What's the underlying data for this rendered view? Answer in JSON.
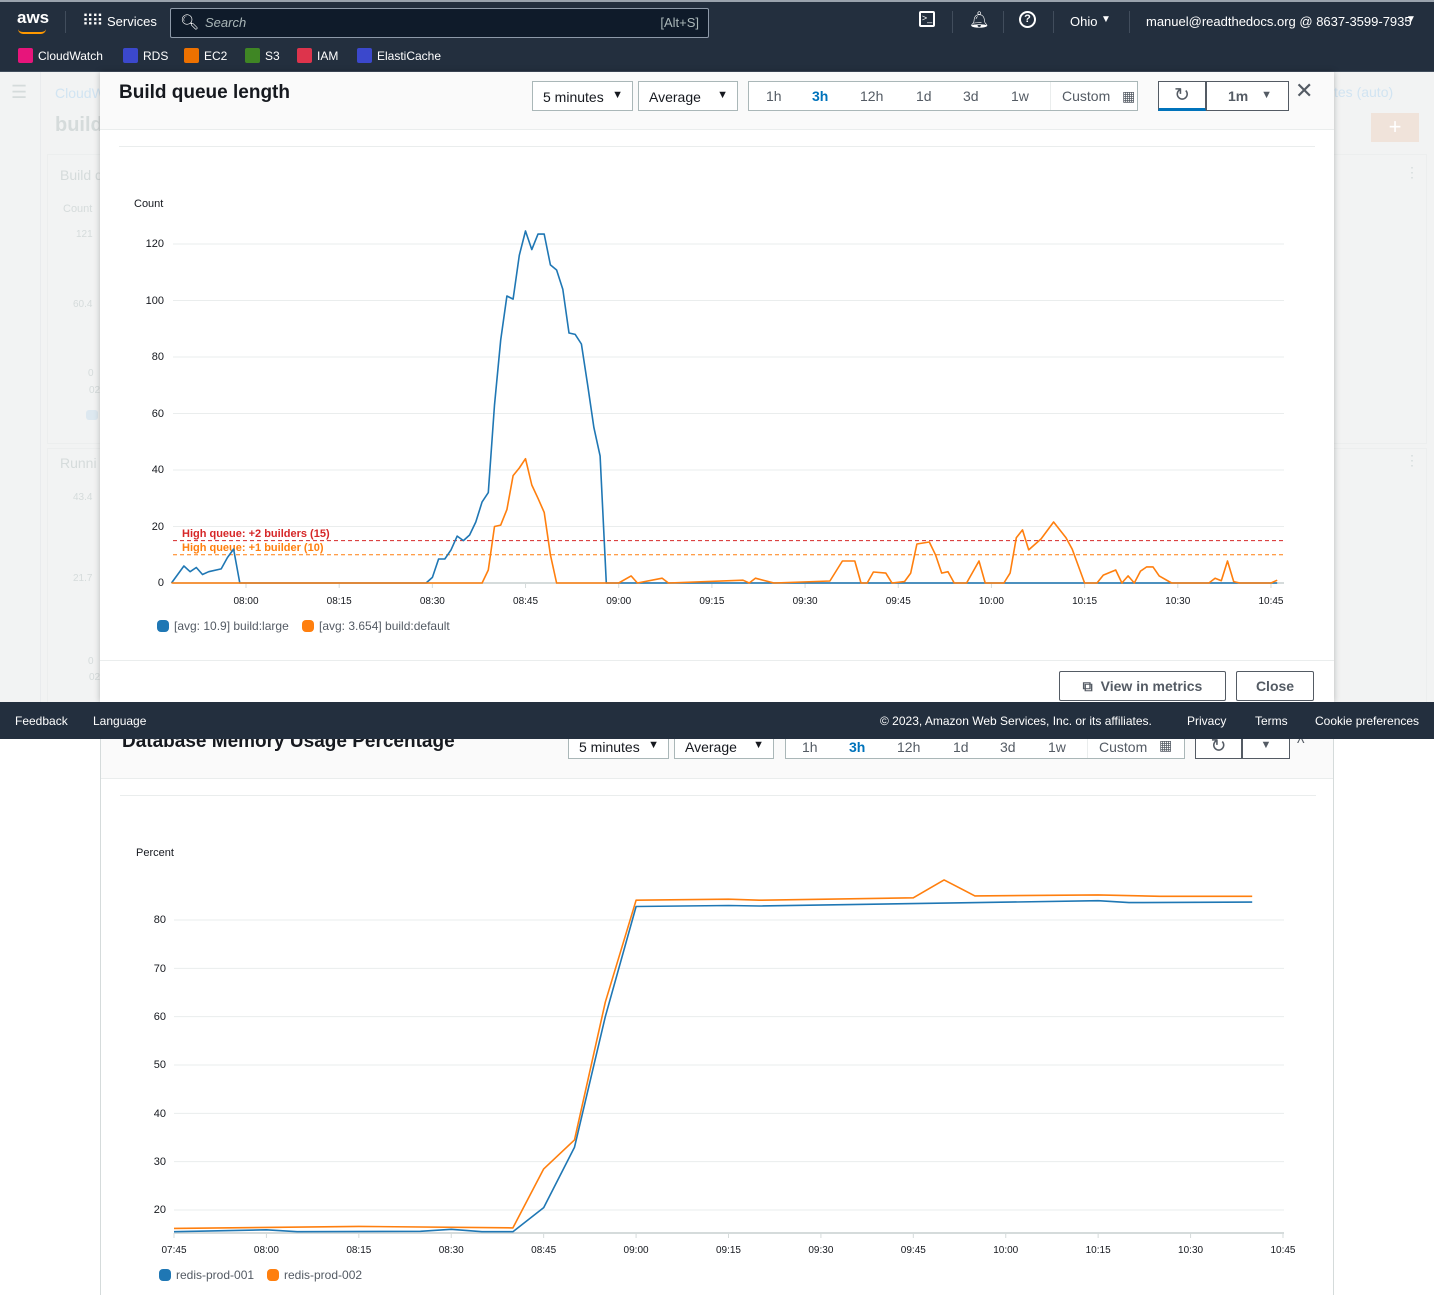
{
  "nav": {
    "logo": "aws",
    "services": "Services",
    "search_placeholder": "Search",
    "search_shortcut": "[Alt+S]",
    "region": "Ohio",
    "account": "manuel@readthedocs.org @ 8637-3599-7935"
  },
  "favorites": [
    {
      "label": "CloudWatch",
      "color": "#e7157b"
    },
    {
      "label": "RDS",
      "color": "#3b48cc"
    },
    {
      "label": "EC2",
      "color": "#ed7100"
    },
    {
      "label": "S3",
      "color": "#3f8624"
    },
    {
      "label": "IAM",
      "color": "#dd344c"
    },
    {
      "label": "ElastiCache",
      "color": "#3b48cc"
    }
  ],
  "background": {
    "breadcrumb": "CloudW",
    "title": "build",
    "widget1_title": "Build q",
    "widget1_unit": "Count",
    "widget1_ticks": [
      "121",
      "60.4",
      "0"
    ],
    "widget1_x": "02",
    "widget2_title": "Runni",
    "widget2_ticks": [
      "43.4",
      "21.7",
      "0"
    ],
    "widget2_x": "02",
    "period_link": "tes (auto)"
  },
  "modal1": {
    "title": "Build queue length",
    "period": "5 minutes",
    "stat": "Average",
    "ranges": [
      "1h",
      "3h",
      "12h",
      "1d",
      "3d",
      "1w"
    ],
    "active_range": "3h",
    "custom": "Custom",
    "refresh_interval": "1m",
    "view_in_metrics": "View in metrics",
    "close": "Close"
  },
  "modal2": {
    "title": "Database Memory Usage Percentage",
    "period": "5 minutes",
    "stat": "Average",
    "ranges": [
      "1h",
      "3h",
      "12h",
      "1d",
      "3d",
      "1w"
    ],
    "active_range": "3h",
    "custom": "Custom"
  },
  "footer": {
    "feedback": "Feedback",
    "language": "Language",
    "copyright": "© 2023, Amazon Web Services, Inc. or its affiliates.",
    "privacy": "Privacy",
    "terms": "Terms",
    "cookies": "Cookie preferences"
  },
  "chart_data": [
    {
      "type": "line",
      "ylabel": "Count",
      "ylim": [
        0,
        120
      ],
      "yticks": [
        "0",
        "20",
        "40",
        "60",
        "80",
        "100",
        "120"
      ],
      "xticks": [
        "08:00",
        "08:15",
        "08:30",
        "08:45",
        "09:00",
        "09:15",
        "09:30",
        "09:45",
        "10:00",
        "10:15",
        "10:30",
        "10:45"
      ],
      "grid": true,
      "legend": "bottom-left",
      "annotations": [
        {
          "label": "High queue: +2 builders (15)",
          "value": 15,
          "color": "#d62728"
        },
        {
          "label": "High queue: +1 builder (10)",
          "value": 10,
          "color": "#ff7f0e"
        }
      ],
      "series": [
        {
          "name": "[avg: 10.9] build:large",
          "color": "#1f77b4",
          "points": [
            [
              "07:48",
              0
            ],
            [
              "07:49",
              3
            ],
            [
              "07:50",
              6
            ],
            [
              "07:51",
              4
            ],
            [
              "07:52",
              5.5
            ],
            [
              "07:53",
              3
            ],
            [
              "07:54",
              4
            ],
            [
              "07:56",
              5
            ],
            [
              "07:57",
              9
            ],
            [
              "07:58",
              12
            ],
            [
              "07:59",
              0
            ],
            [
              "08:29",
              0
            ],
            [
              "08:30",
              2
            ],
            [
              "08:31",
              8.5
            ],
            [
              "08:32",
              8.5
            ],
            [
              "08:33",
              11.7
            ],
            [
              "08:34",
              16.6
            ],
            [
              "08:35",
              15
            ],
            [
              "08:36",
              17
            ],
            [
              "08:37",
              21.6
            ],
            [
              "08:38",
              28.7
            ],
            [
              "08:39",
              32
            ],
            [
              "08:40",
              63
            ],
            [
              "08:41",
              86
            ],
            [
              "08:42",
              101.6
            ],
            [
              "08:43",
              100.5
            ],
            [
              "08:44",
              116
            ],
            [
              "08:45",
              124.6
            ],
            [
              "08:46",
              118
            ],
            [
              "08:47",
              123.5
            ],
            [
              "08:48",
              123.5
            ],
            [
              "08:49",
              112.6
            ],
            [
              "08:50",
              110.8
            ],
            [
              "08:51",
              104
            ],
            [
              "08:52",
              88.5
            ],
            [
              "08:53",
              88
            ],
            [
              "08:54",
              84.6
            ],
            [
              "08:55",
              70
            ],
            [
              "08:56",
              55
            ],
            [
              "08:57",
              45
            ],
            [
              "08:58",
              0
            ],
            [
              "10:46",
              0
            ]
          ]
        },
        {
          "name": "[avg: 3.654] build:default",
          "color": "#ff7f0e",
          "points": [
            [
              "07:48",
              0
            ],
            [
              "08:38",
              0
            ],
            [
              "08:39",
              4.6
            ],
            [
              "08:40",
              20
            ],
            [
              "08:41",
              20.5
            ],
            [
              "08:42",
              26
            ],
            [
              "08:43",
              38
            ],
            [
              "08:44",
              40.7
            ],
            [
              "08:45",
              44
            ],
            [
              "08:46",
              34.7
            ],
            [
              "08:47",
              30
            ],
            [
              "08:48",
              25
            ],
            [
              "08:49",
              10
            ],
            [
              "08:50",
              0
            ],
            [
              "09:00",
              0
            ],
            [
              "09:02",
              2.5
            ],
            [
              "09:03",
              0
            ],
            [
              "09:07",
              1.7
            ],
            [
              "09:08",
              0
            ],
            [
              "09:20",
              1
            ],
            [
              "09:21",
              0
            ],
            [
              "09:22",
              1.7
            ],
            [
              "09:25",
              0
            ],
            [
              "09:34",
              0.7
            ],
            [
              "09:36",
              7.8
            ],
            [
              "09:38",
              7.8
            ],
            [
              "09:39",
              0
            ],
            [
              "09:40",
              0
            ],
            [
              "09:41",
              3.9
            ],
            [
              "09:43",
              3.5
            ],
            [
              "09:44",
              0
            ],
            [
              "09:46",
              0.5
            ],
            [
              "09:47",
              3.5
            ],
            [
              "09:48",
              13.8
            ],
            [
              "09:50",
              14.5
            ],
            [
              "09:51",
              10
            ],
            [
              "09:52",
              3.5
            ],
            [
              "09:53",
              4
            ],
            [
              "09:54",
              0
            ],
            [
              "09:56",
              0
            ],
            [
              "09:57",
              3.9
            ],
            [
              "09:58",
              7.8
            ],
            [
              "09:59",
              0
            ],
            [
              "10:02",
              0
            ],
            [
              "10:03",
              3.5
            ],
            [
              "10:04",
              16
            ],
            [
              "10:05",
              18.8
            ],
            [
              "10:06",
              11.7
            ],
            [
              "10:08",
              15.6
            ],
            [
              "10:10",
              21.6
            ],
            [
              "10:12",
              16
            ],
            [
              "10:13",
              12
            ],
            [
              "10:15",
              0
            ],
            [
              "10:17",
              0
            ],
            [
              "10:18",
              2.8
            ],
            [
              "10:20",
              4.6
            ],
            [
              "10:21",
              0
            ],
            [
              "10:22",
              2.5
            ],
            [
              "10:23",
              0
            ],
            [
              "10:24",
              4.2
            ],
            [
              "10:25",
              5.7
            ],
            [
              "10:26",
              5.7
            ],
            [
              "10:27",
              2.5
            ],
            [
              "10:29",
              0
            ],
            [
              "10:35",
              0
            ],
            [
              "10:36",
              1.7
            ],
            [
              "10:37",
              0.8
            ],
            [
              "10:38",
              7.8
            ],
            [
              "10:39",
              0.5
            ],
            [
              "10:40",
              0
            ],
            [
              "10:45",
              0
            ],
            [
              "10:46",
              1
            ]
          ]
        }
      ]
    },
    {
      "type": "line",
      "ylabel": "Percent",
      "ylim": [
        15,
        88
      ],
      "yticks": [
        "20",
        "30",
        "40",
        "50",
        "60",
        "70",
        "80"
      ],
      "xticks": [
        "07:45",
        "08:00",
        "08:15",
        "08:30",
        "08:45",
        "09:00",
        "09:15",
        "09:30",
        "09:45",
        "10:00",
        "10:15",
        "10:30",
        "10:45"
      ],
      "grid": true,
      "legend": "bottom-left",
      "series": [
        {
          "name": "redis-prod-001",
          "color": "#1f77b4",
          "points": [
            [
              "07:45",
              15.5
            ],
            [
              "08:00",
              15.9
            ],
            [
              "08:05",
              15.5
            ],
            [
              "08:25",
              15.6
            ],
            [
              "08:30",
              16
            ],
            [
              "08:35",
              15.5
            ],
            [
              "08:40",
              15.5
            ],
            [
              "08:45",
              20.5
            ],
            [
              "08:50",
              33
            ],
            [
              "08:55",
              60
            ],
            [
              "09:00",
              82.8
            ],
            [
              "09:15",
              83
            ],
            [
              "09:20",
              82.9
            ],
            [
              "09:45",
              83.4
            ],
            [
              "10:15",
              84
            ],
            [
              "10:20",
              83.6
            ],
            [
              "10:40",
              83.7
            ]
          ]
        },
        {
          "name": "redis-prod-002",
          "color": "#ff7f0e",
          "points": [
            [
              "07:45",
              16.2
            ],
            [
              "08:15",
              16.6
            ],
            [
              "08:40",
              16.3
            ],
            [
              "08:45",
              28.5
            ],
            [
              "08:50",
              34.5
            ],
            [
              "08:55",
              63
            ],
            [
              "09:00",
              84.1
            ],
            [
              "09:15",
              84.3
            ],
            [
              "09:20",
              84.1
            ],
            [
              "09:45",
              84.6
            ],
            [
              "09:50",
              88.3
            ],
            [
              "09:55",
              85
            ],
            [
              "10:15",
              85.2
            ],
            [
              "10:25",
              84.9
            ],
            [
              "10:40",
              84.9
            ]
          ]
        }
      ]
    }
  ]
}
